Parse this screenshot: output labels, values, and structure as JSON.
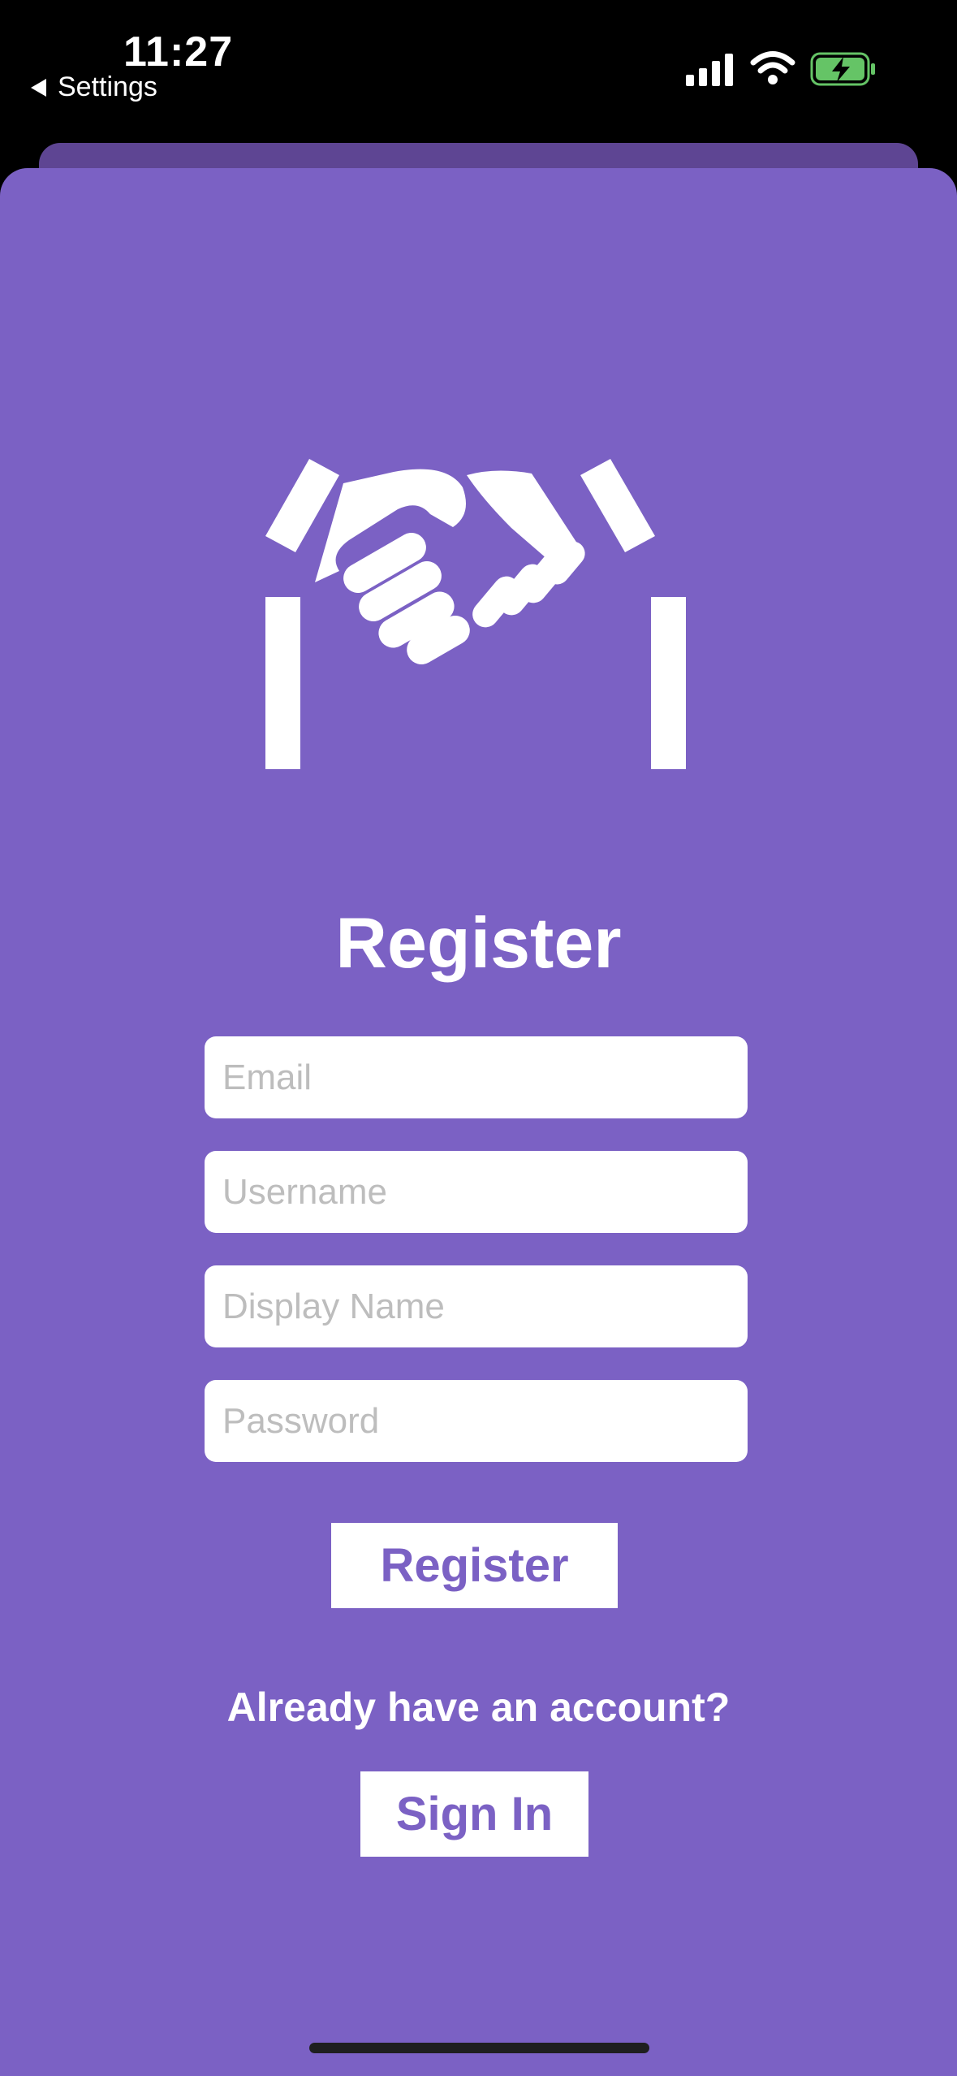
{
  "status_bar": {
    "time": "11:27",
    "back_label": "Settings",
    "icons": [
      "cellular-signal-icon",
      "wifi-icon",
      "battery-charging-icon"
    ],
    "battery_color": "#65C466"
  },
  "brand": {
    "accent": "#7B61C4",
    "sheet_shadow": "#5E4593",
    "logo_icon": "handshake-icon"
  },
  "form": {
    "title": "Register",
    "email_placeholder": "Email",
    "username_placeholder": "Username",
    "display_name_placeholder": "Display Name",
    "password_placeholder": "Password",
    "submit_label": "Register"
  },
  "footer": {
    "prompt": "Already have an account?",
    "sign_in_label": "Sign In"
  }
}
